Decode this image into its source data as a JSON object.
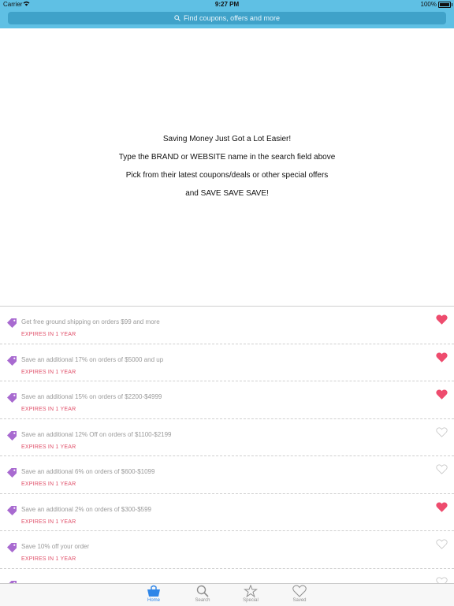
{
  "status_bar": {
    "carrier": "Carrier",
    "time": "9:27 PM",
    "battery": "100%"
  },
  "search": {
    "placeholder": "Find coupons, offers and more"
  },
  "intro": {
    "line1": "Saving Money Just Got a Lot Easier!",
    "line2": "Type the BRAND or WEBSITE name in the search field above",
    "line3": "Pick from their latest coupons/deals or other special offers",
    "line4": "and SAVE SAVE SAVE!"
  },
  "deals": [
    {
      "title": "Get free ground shipping on orders $99 and more",
      "expires": "EXPIRES IN 1 YEAR",
      "saved": true
    },
    {
      "title": "Save an additional 17% on orders of $5000 and up",
      "expires": "EXPIRES IN 1 YEAR",
      "saved": true
    },
    {
      "title": "Save an additional 15% on orders of $2200-$4999",
      "expires": "EXPIRES IN 1 YEAR",
      "saved": true
    },
    {
      "title": "Save an additional 12% Off on orders of $1100-$2199",
      "expires": "EXPIRES IN 1 YEAR",
      "saved": false
    },
    {
      "title": "Save an additional 6% on orders of $600-$1099",
      "expires": "EXPIRES IN 1 YEAR",
      "saved": false
    },
    {
      "title": "Save an additional 2% on orders of $300-$599",
      "expires": "EXPIRES IN 1 YEAR",
      "saved": true
    },
    {
      "title": "Save 10% off your order",
      "expires": "EXPIRES IN 1 YEAR",
      "saved": false
    },
    {
      "title": "",
      "expires": "",
      "saved": false
    }
  ],
  "tabs": [
    {
      "label": "Home",
      "icon": "shopping-bag-icon",
      "active": true
    },
    {
      "label": "Search",
      "icon": "search-icon",
      "active": false
    },
    {
      "label": "Special",
      "icon": "star-icon",
      "active": false
    },
    {
      "label": "Saved",
      "icon": "heart-icon",
      "active": false
    }
  ],
  "colors": {
    "header": "#5fc0e4",
    "search_field": "#3fa2c9",
    "tag": "#a86ad0",
    "heart_saved": "#ee4c6e",
    "expires": "#e0506a",
    "tab_active": "#2f86e8"
  }
}
